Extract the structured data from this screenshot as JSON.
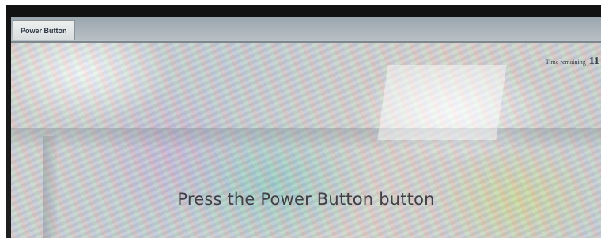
{
  "tab": {
    "label": "Power Button"
  },
  "timer": {
    "label": "Time remaining",
    "value": "11"
  },
  "instruction": {
    "text": "Press the Power Button button"
  },
  "colors": {
    "tab_strip": "#9aa6ae",
    "tab_background": "#e6e9ea",
    "text": "#3f3f44",
    "bezel": "#1a1a1a"
  }
}
